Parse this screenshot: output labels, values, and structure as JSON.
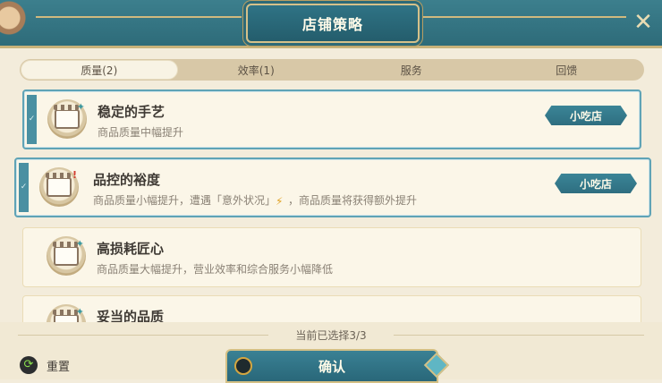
{
  "header": {
    "title": "店铺策略",
    "close_icon": "close-icon"
  },
  "tabs": [
    {
      "label": "质量(2)",
      "active": true
    },
    {
      "label": "效率(1)",
      "active": false
    },
    {
      "label": "服务",
      "active": false
    },
    {
      "label": "回馈",
      "active": false
    }
  ],
  "strategies": [
    {
      "name": "稳定的手艺",
      "desc": "商品质量中幅提升",
      "badge": "小吃店",
      "selected": true,
      "icon": "shop-icon"
    },
    {
      "name": "品控的裕度",
      "desc_a": "商品质量小幅提升，遭遇「意外状况」",
      "desc_b": "，商品质量将获得额外提升",
      "badge": "小吃店",
      "selected": true,
      "icon": "shop-alert-icon"
    },
    {
      "name": "高损耗匠心",
      "desc": "商品质量大幅提升，营业效率和综合服务小幅降低",
      "selected": false,
      "icon": "shop-icon"
    },
    {
      "name": "妥当的品质",
      "desc": "",
      "selected": false,
      "icon": "shop-icon"
    }
  ],
  "footer": {
    "selection_text": "当前已选择3/3",
    "reset_label": "重置",
    "confirm_label": "确认"
  },
  "colors": {
    "accent": "#2d6a78",
    "gold": "#d4c085",
    "selected_border": "#5fa3b6"
  }
}
